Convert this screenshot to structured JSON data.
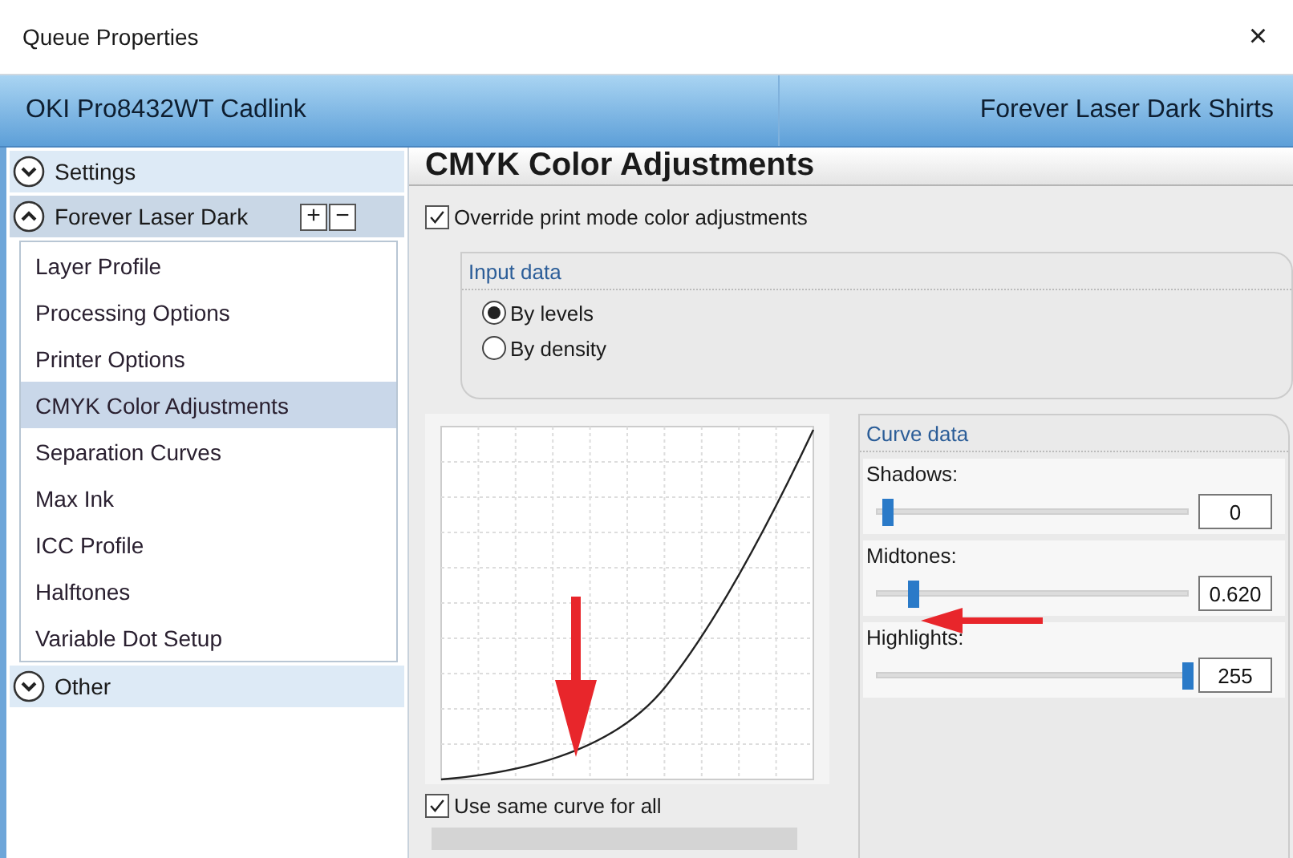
{
  "window": {
    "title": "Queue Properties",
    "close": "×"
  },
  "header": {
    "printer": "OKI Pro8432WT Cadlink",
    "mode": "Forever Laser Dark Shirts"
  },
  "sidebar": {
    "sections": [
      {
        "label": "Settings",
        "expanded": false
      },
      {
        "label": "Forever Laser Dark",
        "expanded": true,
        "buttons": [
          "+",
          "−"
        ],
        "items": [
          {
            "label": "Layer Profile",
            "selected": false
          },
          {
            "label": "Processing Options",
            "selected": false
          },
          {
            "label": "Printer Options",
            "selected": false
          },
          {
            "label": "CMYK Color Adjustments",
            "selected": true
          },
          {
            "label": "Separation Curves",
            "selected": false
          },
          {
            "label": "Max Ink",
            "selected": false
          },
          {
            "label": "ICC Profile",
            "selected": false
          },
          {
            "label": "Halftones",
            "selected": false
          },
          {
            "label": "Variable Dot Setup",
            "selected": false
          }
        ]
      },
      {
        "label": "Other",
        "expanded": false
      }
    ]
  },
  "content": {
    "title": "CMYK Color Adjustments",
    "override": {
      "label": "Override print mode color adjustments",
      "checked": true
    },
    "input_data": {
      "title": "Input data",
      "options": [
        {
          "label": "By levels",
          "selected": true
        },
        {
          "label": "By density",
          "selected": false
        }
      ]
    },
    "use_same_curve": {
      "label": "Use same curve for all",
      "checked": true
    },
    "curve_data": {
      "title": "Curve data",
      "sliders": [
        {
          "label": "Shadows:",
          "level": 0.02,
          "value": "0"
        },
        {
          "label": "Midtones:",
          "level": 0.1,
          "value": "0.620"
        },
        {
          "label": "Highlights:",
          "level": 0.98,
          "value": "255"
        }
      ]
    }
  }
}
